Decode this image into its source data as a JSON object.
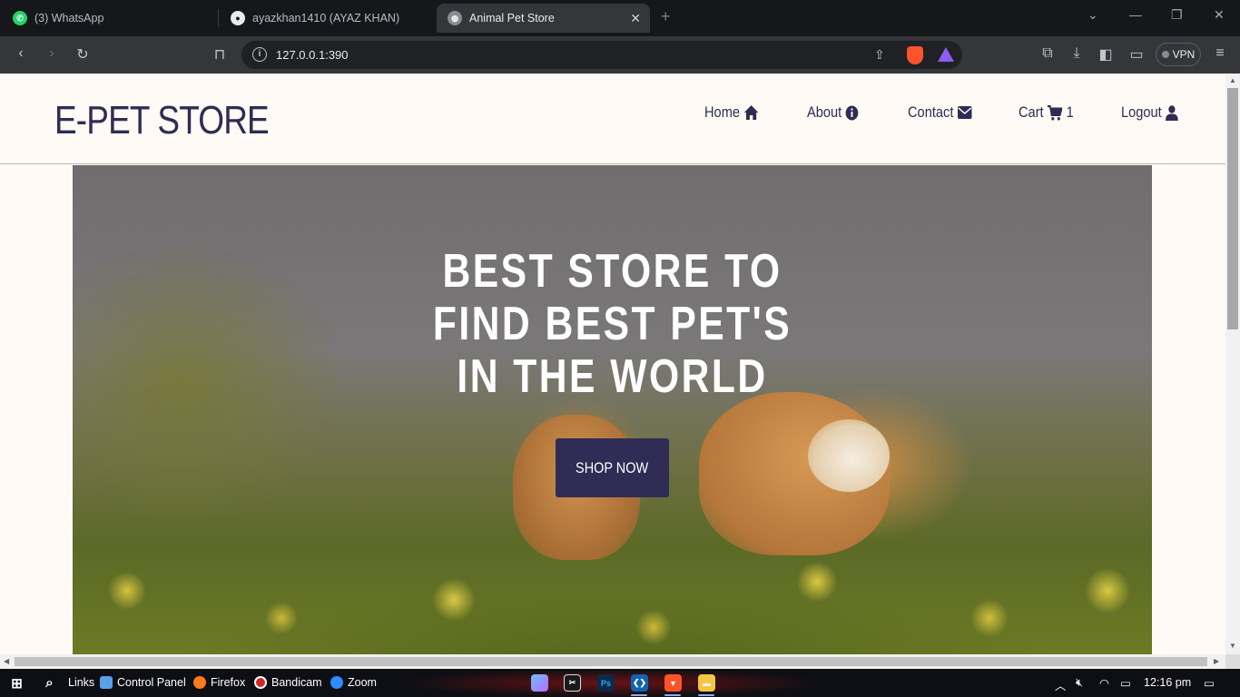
{
  "browser": {
    "tabs": [
      {
        "title": "(3) WhatsApp",
        "icon": "whatsapp-icon",
        "active": false
      },
      {
        "title": "ayazkhan1410 (AYAZ KHAN)",
        "icon": "github-icon",
        "active": false
      },
      {
        "title": "Animal Pet Store",
        "icon": "globe-icon",
        "active": true
      }
    ],
    "url": "127.0.0.1:390",
    "vpn_label": "VPN"
  },
  "site": {
    "brand": "E-PET STORE",
    "nav": [
      {
        "label": "Home",
        "icon": "home-icon"
      },
      {
        "label": "About",
        "icon": "info-icon"
      },
      {
        "label": "Contact",
        "icon": "envelope-icon"
      },
      {
        "label": "Cart",
        "icon": "cart-icon",
        "count": "1"
      },
      {
        "label": "Logout",
        "icon": "user-icon"
      }
    ],
    "hero": {
      "title_lines": [
        "BEST STORE TO",
        "FIND BEST PET'S",
        "IN THE WORLD"
      ],
      "button_label": "SHOP NOW"
    }
  },
  "taskbar": {
    "items": [
      {
        "label": "Links"
      },
      {
        "label": "Control Panel"
      },
      {
        "label": "Firefox"
      },
      {
        "label": "Bandicam"
      },
      {
        "label": "Zoom"
      }
    ],
    "time": "12:16 pm"
  },
  "colors": {
    "brand_navy": "#2f2c52",
    "page_bg": "#fffaf5",
    "button_bg": "#302c56"
  }
}
